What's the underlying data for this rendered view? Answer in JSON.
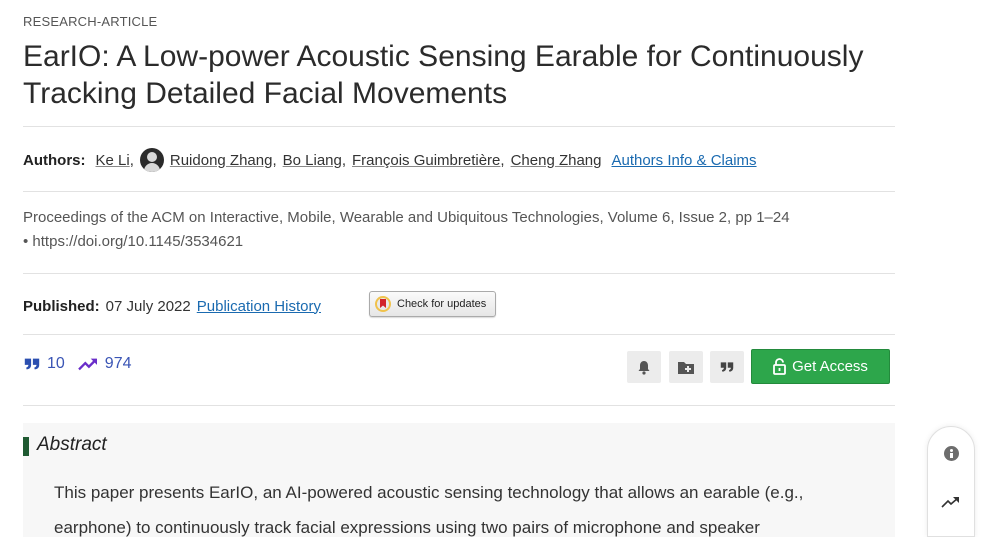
{
  "article": {
    "type_label": "RESEARCH-ARTICLE",
    "title": "EarIO: A Low-power Acoustic Sensing Earable for Continuously Tracking Detailed Facial Movements"
  },
  "authors": {
    "label": "Authors:",
    "names": [
      "Ke Li",
      "Ruidong Zhang",
      "Bo Liang",
      "François Guimbretière",
      "Cheng Zhang"
    ],
    "info_link": "Authors Info & Claims"
  },
  "publication": {
    "proceedings": "Proceedings of the ACM on Interactive, Mobile, Wearable and Ubiquitous Technologies, Volume 6, Issue 2, pp 1–24 • https://doi.org/10.1145/3534621",
    "published_label": "Published:",
    "date": "07 July 2022",
    "history_link": "Publication History",
    "check_updates_label": "Check for updates"
  },
  "metrics": {
    "citations": "10",
    "downloads": "974"
  },
  "actions": {
    "get_access_label": "Get Access"
  },
  "abstract": {
    "heading": "Abstract",
    "text": "This paper presents EarIO, an AI-powered acoustic sensing technology that allows an earable (e.g., earphone) to continuously track facial expressions using two pairs of microphone and speaker"
  },
  "colors": {
    "link": "#1a6ab0",
    "metric": "#3a55b5",
    "access_button": "#2da64b",
    "abstract_bar": "#1f5a32"
  },
  "icons": [
    "avatar",
    "check-updates-icon",
    "quote-icon",
    "trend-icon",
    "bell-icon",
    "folder-add-icon",
    "cite-icon",
    "lock-icon",
    "info-icon",
    "trend-icon"
  ]
}
